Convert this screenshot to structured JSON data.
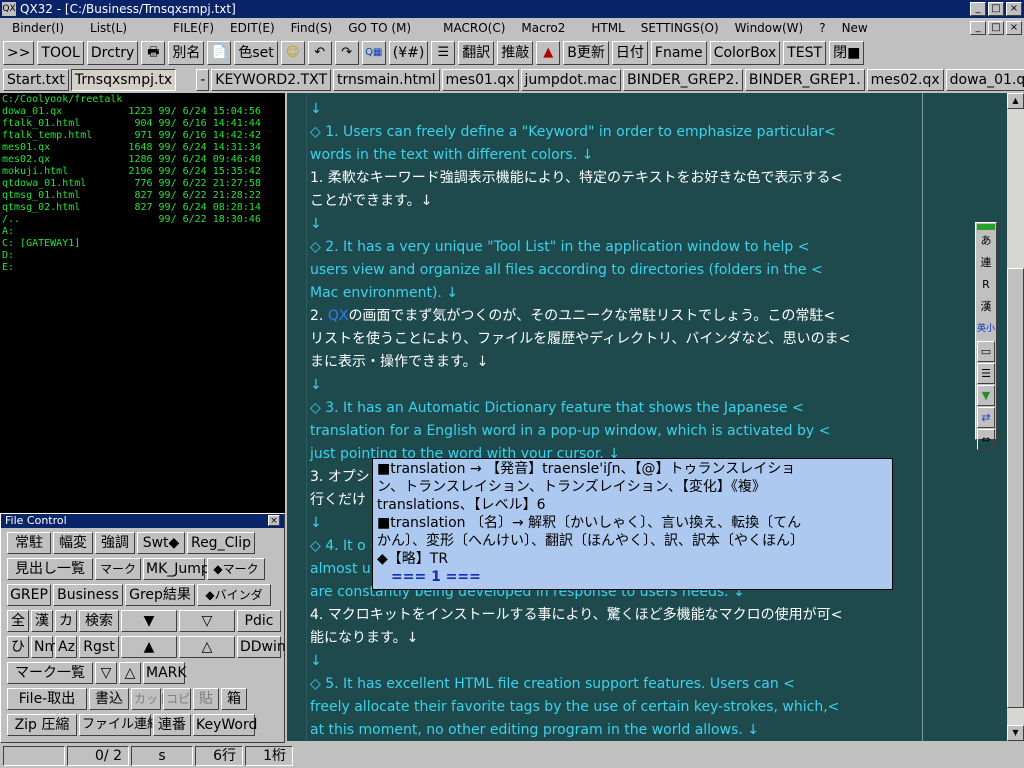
{
  "window": {
    "title": "QX32 - [C:/Business/Trnsqxsmpj.txt]",
    "icon": "QX"
  },
  "window_buttons": [
    "_",
    "□",
    "×"
  ],
  "menu": [
    "Binder(I)",
    "List(L)",
    "FILE(F)",
    "EDIT(E)",
    "Find(S)",
    "GO TO (M)",
    "MACRO(C)",
    "Macro2",
    "HTML",
    "SETTINGS(O)",
    "Window(W)",
    "?",
    "New"
  ],
  "toolbar": [
    ">>",
    "TOOL",
    "Drctry",
    "🖶",
    "別名",
    "📄",
    "色set",
    "☺",
    "↶",
    "↷",
    "Q▦",
    "(¥#)",
    "☰",
    "翻訳",
    "推敲",
    "▲",
    "B更新",
    "日付",
    "Fname",
    "ColorBox",
    "TEST",
    "閉■"
  ],
  "tabs": [
    "Start.txt",
    "Trnsqxsmpj.tx",
    "-",
    "KEYWORD2.TXT",
    "trnsmain.html",
    "mes01.qx",
    "jumpdot.mac",
    "BINDER_GREP2.",
    "BINDER_GREP1.",
    "mes02.qx",
    "dowa_01.qx"
  ],
  "filelist": [
    "C:/Coolyook/freetalk",
    "dowa_01.qx           1223 99/ 6/24 15:04:56",
    "ftalk_01.html         904 99/ 6/16 14:41:44",
    "ftalk_temp.html       971 99/ 6/16 14:42:42",
    "mes01.qx             1648 99/ 6/24 14:31:34",
    "mes02.qx             1286 99/ 6/24 09:46:40",
    "mokuji.html          2196 99/ 6/24 15:35:42",
    "qtdowa_01.html        776 99/ 6/22 21:27:58",
    "qtmsg_01.html         827 99/ 6/22 21:28:22",
    "qtmsg_02.html         827 99/ 6/24 08:28:14",
    "/..                       99/ 6/22 18:30:46",
    "A:",
    "C: [GATEWAY1]",
    "D:",
    "E:"
  ],
  "file_control": {
    "title": "File Control",
    "close": "×",
    "rows": [
      [
        "常駐",
        "幅変",
        "強調",
        "Swt◆",
        "Reg_Clip"
      ],
      [
        "見出し一覧",
        "マーク",
        "MK_Jump",
        "◆マーク"
      ],
      [
        "GREP",
        "Business",
        "Grep結果",
        "◆バインダ"
      ],
      [
        "全",
        "漢",
        "カ",
        "検索",
        "▼",
        "▽",
        "Pdic"
      ],
      [
        "ひ",
        "Nm",
        "Az",
        "Rgst",
        "▲",
        "△",
        "DDwin"
      ],
      [
        "マーク一覧",
        "▽",
        "△",
        "MARK"
      ],
      [
        "File-取出",
        "書込",
        "カット",
        "コピ",
        "貼",
        "箱"
      ],
      [
        "Zip 圧縮",
        "ファイル連結",
        "連番",
        "KeyWord"
      ]
    ]
  },
  "editor_lines": [
    {
      "t": "blank",
      "s": "↓"
    },
    {
      "t": "en",
      "s": "◇  1. Users can freely define a \"Keyword\"  in order to emphasize particular<"
    },
    {
      "t": "en",
      "s": " words in the text with different colors. ↓"
    },
    {
      "t": "ja",
      "s": "1. 柔軟なキーワード強調表示機能により、特定のテキストをお好きな色で表示する<"
    },
    {
      "t": "ja",
      "s": "ことができます。↓"
    },
    {
      "t": "blank",
      "s": "↓"
    },
    {
      "t": "en",
      "s": "◇  2. It has a very unique \"Tool List\" in the application window to help <"
    },
    {
      "t": "en",
      "s": "users view and organize all files according to directories (folders in the <"
    },
    {
      "t": "en",
      "s": "Mac environment).  ↓"
    },
    {
      "t": "ja",
      "s": "2. QXの画面でまず気がつくのが、そのユニークな常駐リストでしょう。この常駐<"
    },
    {
      "t": "ja",
      "s": "リストを使うことにより、ファイルを履歴やディレクトリ、バインダなど、思いのま<"
    },
    {
      "t": "ja",
      "s": "まに表示・操作できます。↓"
    },
    {
      "t": "blank",
      "s": "↓"
    },
    {
      "t": "en",
      "s": "◇  3. It has an Automatic Dictionary feature that shows the Japanese <"
    },
    {
      "t": "en",
      "s": "translation for a English word in  a pop-up window, which is activated by <"
    },
    {
      "t": "en",
      "s": "just pointing to the word with your cursor. ↓"
    },
    {
      "t": "ja",
      "s": "3. オプショ                                                      て<"
    },
    {
      "t": "ja",
      "s": "行くだけ                                                       ます。↓"
    },
    {
      "t": "blank",
      "s": "↓"
    },
    {
      "t": "en",
      "s": "◇  4. It                                                        o <"
    },
    {
      "t": "en",
      "s": "almost u                                                        s <"
    },
    {
      "t": "en",
      "s": "are constantly being developed in response to users needs.  ↓"
    },
    {
      "t": "ja",
      "s": "4. マクロキットをインストールする事により、驚くほど多機能なマクロの使用が可<"
    },
    {
      "t": "ja",
      "s": "能になります。↓"
    },
    {
      "t": "blank",
      "s": "↓"
    },
    {
      "t": "en",
      "s": "◇  5. It has excellent HTML file creation support features. Users can <"
    },
    {
      "t": "en",
      "s": "freely allocate their favorite tags by the use of certain key-strokes, which,<"
    },
    {
      "t": "en",
      "s": " at this moment, no other editing program in the world allows. ↓"
    }
  ],
  "popup_lines": [
    "■translation → 【発音】traensle'iʃn、【@】トゥランスレイショ",
    "ン、トランスレイション、トランズレイション、【変化】《複》",
    "translations、【レベル】6",
    "■translation 〔名〕→ 解釈〔かいしゃく〕、言い換え、転換〔てん",
    "かん〕、変形〔へんけい〕、翻訳〔ほんやく〕、訳、訳本〔やくほん〕",
    "◆【略】TR"
  ],
  "popup_footer": "=== 1 ===",
  "float_toolbar": [
    "あ",
    "連",
    "R",
    "漢",
    "英小",
    "▭",
    "☰",
    "▼",
    "⇄",
    "⇔"
  ],
  "status": {
    "cells": [
      "",
      "0/ 2",
      "s",
      "6行",
      "1桁"
    ]
  },
  "colors": {
    "editor_bg": "#1e4a4e",
    "english_text": "#3bd2ea",
    "japanese_text": "#ffffff",
    "file_text": "#27e23a",
    "popup_bg": "#aec9f0",
    "title_bg": "#0a246a"
  }
}
